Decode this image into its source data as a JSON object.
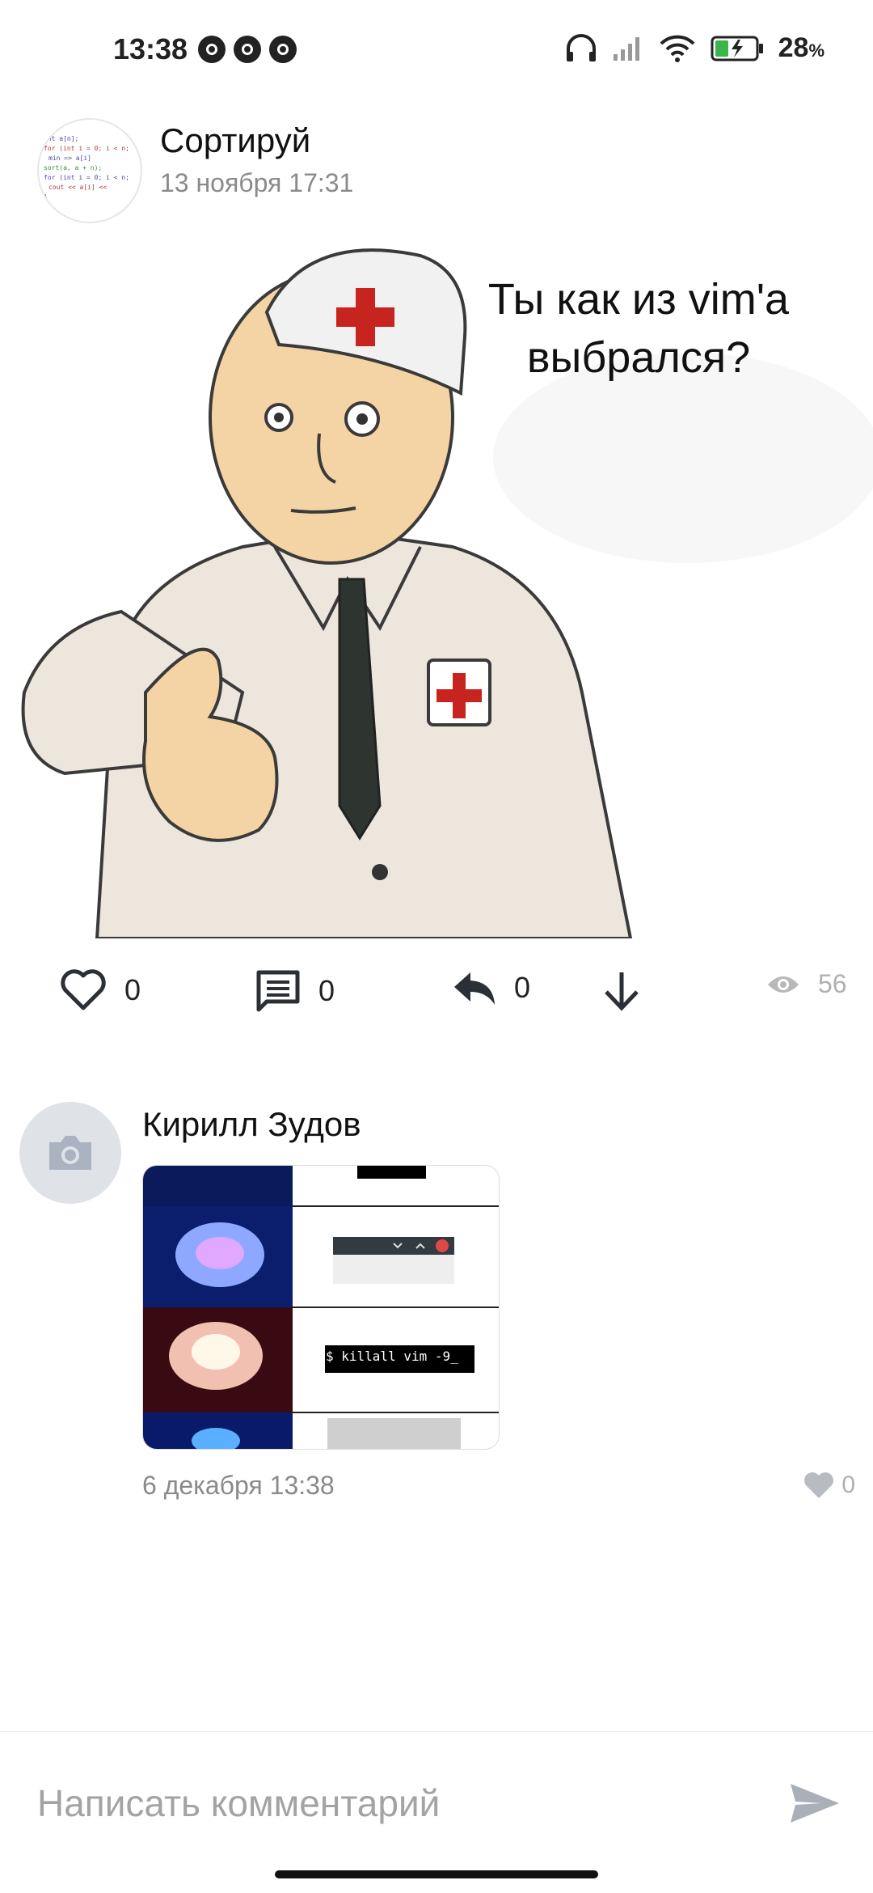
{
  "status_bar": {
    "time": "13:38",
    "battery": "28",
    "battery_unit": "%"
  },
  "post": {
    "author": "Сортируй",
    "date": "13 ноября 17:31",
    "image_caption": "Ты как из vim'a выбрался?",
    "likes": "0",
    "comments": "0",
    "reposts": "0",
    "views": "56"
  },
  "comment": {
    "author": "Кирилл Зудов",
    "image_terminal_text": "$ killall vim -9_",
    "date": "6 декабря 13:38",
    "likes": "0"
  },
  "input": {
    "placeholder": "Написать комментарий"
  },
  "colors": {
    "icon_dark": "#2b2f36",
    "muted": "#8a8a8a",
    "red_cross": "#c8241f",
    "coat": "#ece6dc",
    "skin": "#f4d3a4"
  }
}
